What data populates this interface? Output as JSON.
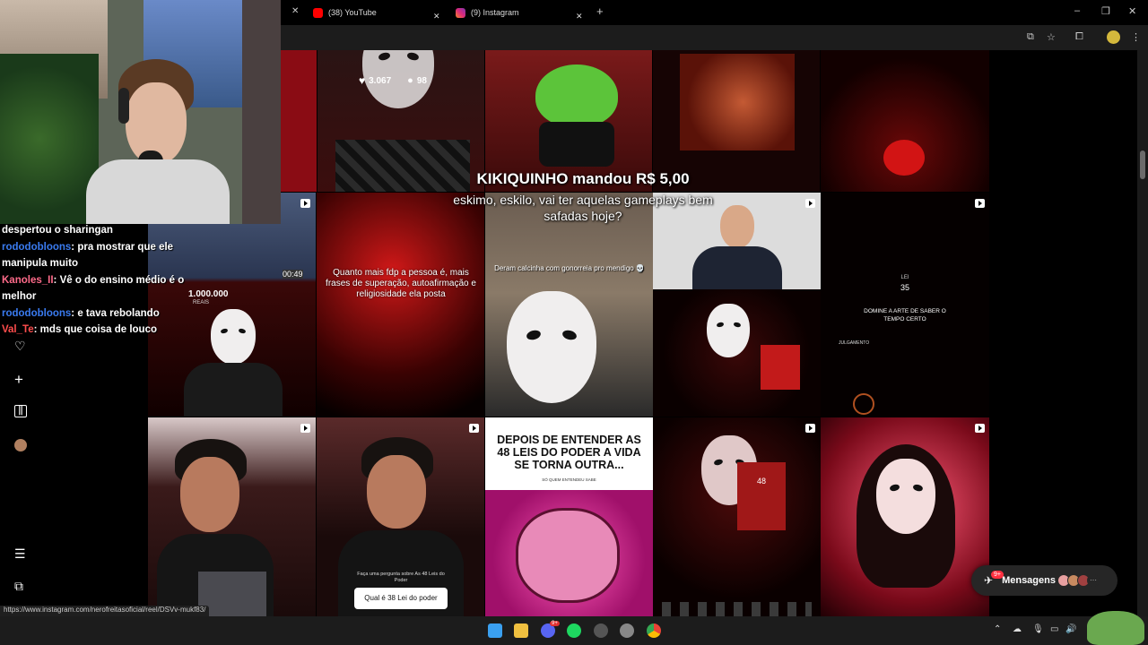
{
  "browser": {
    "tabs": [
      {
        "label": "(38) YouTube",
        "color": "#ff0000"
      },
      {
        "label": "(9) Instagram",
        "color": "#e1306c"
      }
    ],
    "new_tab": "+",
    "window_controls": [
      "–",
      "❐",
      "✕"
    ]
  },
  "instagram": {
    "top_post_stats": {
      "likes": "3.067",
      "comments": "98"
    },
    "posts": {
      "quote_text": "Quanto mais fdp a pessoa é, mais frases de superação, autoafirmação e religiosidade ela posta",
      "meme_caption": "Deram calcinha com gonorreia pro mendigo 💀",
      "money_label": "1.000.000",
      "money_sub": "REAIS",
      "time_text": "00:49",
      "lei_label": "LEI",
      "lei_number": "35",
      "lei_title": "DOMINE A ARTE DE SABER O TEMPO CERTO",
      "lei_body_head": "JULGAMENTO",
      "headline": "DEPOIS DE ENTENDER AS 48 LEIS DO PODER A VIDA SE TORNA OUTRA...",
      "headline_sub": "SÓ QUEM ENTENDEU SABE",
      "question_prompt": "Faça uma pergunta sobre As 48 Leis do Poder",
      "question_answer": "Qual é 38 Lei do poder",
      "book_number": "48"
    },
    "messages": {
      "label": "Mensagens",
      "badge": "9+"
    }
  },
  "chat": [
    {
      "user": "",
      "text": "despertou o sharingan"
    },
    {
      "user": "rododobloons",
      "text": "pra mostrar que ele manipula muito",
      "color": "#3a7bf0"
    },
    {
      "user": "Kanoles_II",
      "text": "Vê o do ensino médio é o melhor",
      "color": "#ff6b8a"
    },
    {
      "user": "rododobloons",
      "text": "e tava rebolando",
      "color": "#3a7bf0"
    },
    {
      "user": "Val_Te",
      "text": "mds que coisa de louco",
      "color": "#ff4d4d"
    }
  ],
  "donation": {
    "header": "KIKIQUINHO mandou R$ 5,00",
    "message": "eskimo, eskilo, vai ter aquelas gameplays bem safadas hoje?"
  },
  "status_url": "https://www.instagram.com/nerofreitasoficial/reel/DSVv-mukf83/",
  "taskbar": {
    "badge": "9+"
  }
}
